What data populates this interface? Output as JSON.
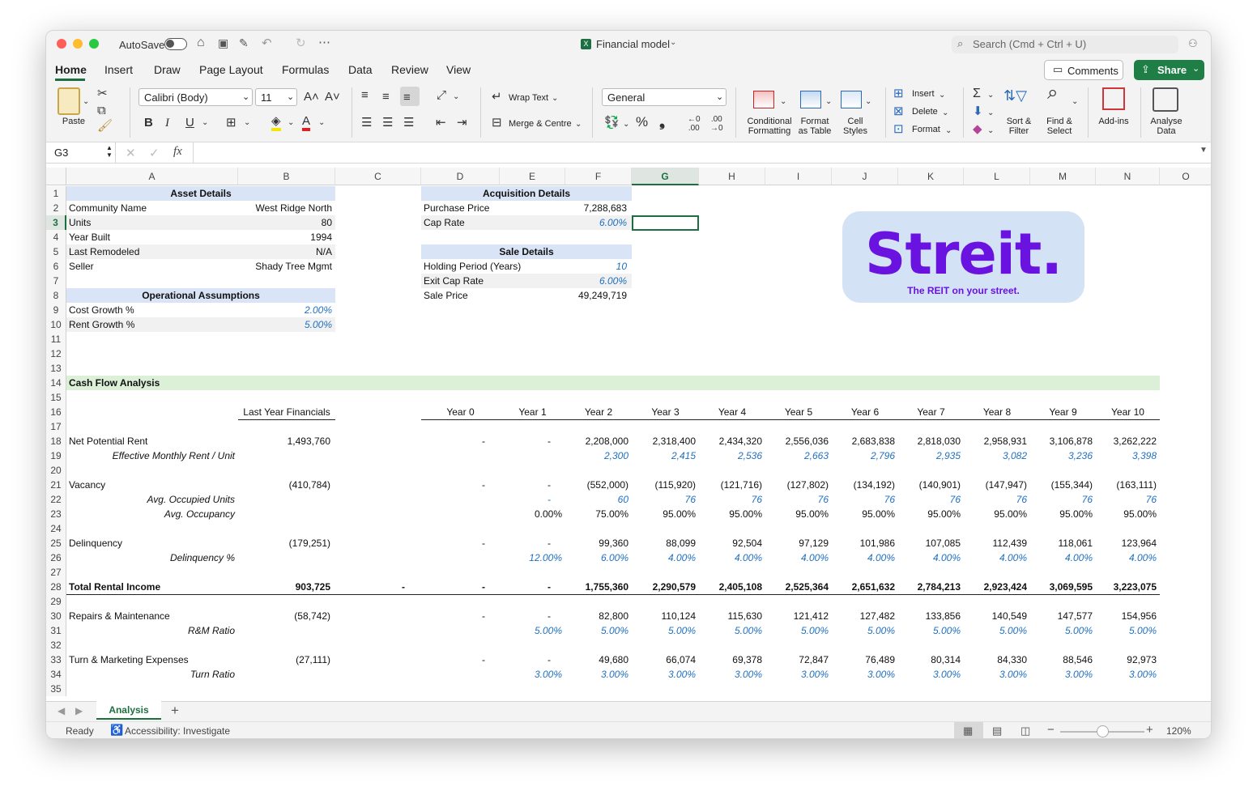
{
  "app": {
    "autosave": "AutoSave",
    "title": "Financial model",
    "search_placeholder": "Search (Cmd + Ctrl + U)"
  },
  "tabs": [
    "Home",
    "Insert",
    "Draw",
    "Page Layout",
    "Formulas",
    "Data",
    "Review",
    "View"
  ],
  "buttons": {
    "comments": "Comments",
    "share": "Share"
  },
  "ribbon": {
    "paste": "Paste",
    "font_name": "Calibri (Body)",
    "font_size": "11",
    "wrap_text": "Wrap Text",
    "merge": "Merge & Centre",
    "number_format": "General",
    "cond_fmt_1": "Conditional",
    "cond_fmt_2": "Formatting",
    "fmt_table_1": "Format",
    "fmt_table_2": "as Table",
    "cell_styles_1": "Cell",
    "cell_styles_2": "Styles",
    "insert": "Insert",
    "delete": "Delete",
    "format": "Format",
    "sort_1": "Sort &",
    "sort_2": "Filter",
    "find_1": "Find &",
    "find_2": "Select",
    "addins": "Add-ins",
    "analyse_1": "Analyse",
    "analyse_2": "Data"
  },
  "formula_bar": {
    "name_box": "G3",
    "fx": "fx",
    "value": ""
  },
  "columns": [
    "A",
    "B",
    "C",
    "D",
    "E",
    "F",
    "G",
    "H",
    "I",
    "J",
    "K",
    "L",
    "M",
    "N",
    "O"
  ],
  "rows": [
    "1",
    "2",
    "3",
    "4",
    "5",
    "6",
    "7",
    "8",
    "9",
    "10",
    "11",
    "12",
    "13",
    "14",
    "15",
    "16",
    "17",
    "18",
    "19",
    "20",
    "21",
    "22",
    "23",
    "24",
    "25",
    "26",
    "27",
    "28",
    "29",
    "30",
    "31",
    "32",
    "33",
    "34",
    "35"
  ],
  "asset": {
    "title": "Asset Details",
    "rows": [
      [
        "Community Name",
        "West Ridge North"
      ],
      [
        "Units",
        "80"
      ],
      [
        "Year Built",
        "1994"
      ],
      [
        "Last Remodeled",
        "N/A"
      ],
      [
        "Seller",
        "Shady Tree Mgmt"
      ]
    ]
  },
  "ops": {
    "title": "Operational Assumptions",
    "rows": [
      [
        "Cost Growth %",
        "2.00%"
      ],
      [
        "Rent Growth %",
        "5.00%"
      ]
    ]
  },
  "acq": {
    "title": "Acquisition Details",
    "rows": [
      [
        "Purchase Price",
        "7,288,683"
      ],
      [
        "Cap Rate",
        "6.00%"
      ]
    ]
  },
  "sale": {
    "title": "Sale Details",
    "rows": [
      [
        "Holding Period (Years)",
        "10"
      ],
      [
        "Exit Cap Rate",
        "6.00%"
      ],
      [
        "Sale Price",
        "49,249,719"
      ]
    ]
  },
  "logo": {
    "name": "Streit.",
    "tagline": "The REIT on your street."
  },
  "cashflow": {
    "title": "Cash Flow Analysis",
    "last_year": "Last Year Financials",
    "years": [
      "Year 0",
      "Year 1",
      "Year 2",
      "Year 3",
      "Year 4",
      "Year 5",
      "Year 6",
      "Year 7",
      "Year 8",
      "Year 9",
      "Year 10"
    ],
    "lines": [
      {
        "row": 18,
        "label": "Net Potential Rent",
        "b": "1,493,760",
        "c": "",
        "vals": [
          "-",
          "-",
          "2,208,000",
          "2,318,400",
          "2,434,320",
          "2,556,036",
          "2,683,838",
          "2,818,030",
          "2,958,931",
          "3,106,878",
          "3,262,222"
        ],
        "style": "plain"
      },
      {
        "row": 19,
        "label": "Effective Monthly Rent / Unit",
        "b": "",
        "c": "",
        "vals": [
          "",
          "",
          "2,300",
          "2,415",
          "2,536",
          "2,663",
          "2,796",
          "2,935",
          "3,082",
          "3,236",
          "3,398"
        ],
        "style": "sub"
      },
      {
        "row": 21,
        "label": "Vacancy",
        "b": "(410,784)",
        "c": "",
        "vals": [
          "-",
          "-",
          "(552,000)",
          "(115,920)",
          "(121,716)",
          "(127,802)",
          "(134,192)",
          "(140,901)",
          "(147,947)",
          "(155,344)",
          "(163,111)"
        ],
        "style": "plain"
      },
      {
        "row": 22,
        "label": "Avg. Occupied Units",
        "b": "",
        "c": "",
        "vals": [
          "",
          "-",
          "60",
          "76",
          "76",
          "76",
          "76",
          "76",
          "76",
          "76",
          "76"
        ],
        "style": "sub"
      },
      {
        "row": 23,
        "label": "Avg. Occupancy",
        "b": "",
        "c": "",
        "vals": [
          "",
          "0.00%",
          "75.00%",
          "95.00%",
          "95.00%",
          "95.00%",
          "95.00%",
          "95.00%",
          "95.00%",
          "95.00%",
          "95.00%"
        ],
        "style": "subblack"
      },
      {
        "row": 25,
        "label": "Delinquency",
        "b": "(179,251)",
        "c": "",
        "vals": [
          "-",
          "-",
          "99,360",
          "88,099",
          "92,504",
          "97,129",
          "101,986",
          "107,085",
          "112,439",
          "118,061",
          "123,964"
        ],
        "style": "plain"
      },
      {
        "row": 26,
        "label": "Delinquency %",
        "b": "",
        "c": "",
        "vals": [
          "",
          "12.00%",
          "6.00%",
          "4.00%",
          "4.00%",
          "4.00%",
          "4.00%",
          "4.00%",
          "4.00%",
          "4.00%",
          "4.00%"
        ],
        "style": "sub"
      },
      {
        "row": 28,
        "label": "Total Rental Income",
        "b": "903,725",
        "c": "-",
        "vals": [
          "-",
          "-",
          "1,755,360",
          "2,290,579",
          "2,405,108",
          "2,525,364",
          "2,651,632",
          "2,784,213",
          "2,923,424",
          "3,069,595",
          "3,223,075"
        ],
        "style": "bold"
      },
      {
        "row": 30,
        "label": "Repairs & Maintenance",
        "b": "(58,742)",
        "c": "",
        "vals": [
          "-",
          "-",
          "82,800",
          "110,124",
          "115,630",
          "121,412",
          "127,482",
          "133,856",
          "140,549",
          "147,577",
          "154,956"
        ],
        "style": "plain"
      },
      {
        "row": 31,
        "label": "R&M Ratio",
        "b": "",
        "c": "",
        "vals": [
          "",
          "5.00%",
          "5.00%",
          "5.00%",
          "5.00%",
          "5.00%",
          "5.00%",
          "5.00%",
          "5.00%",
          "5.00%",
          "5.00%"
        ],
        "style": "sub"
      },
      {
        "row": 33,
        "label": "Turn & Marketing Expenses",
        "b": "(27,111)",
        "c": "",
        "vals": [
          "-",
          "-",
          "49,680",
          "66,074",
          "69,378",
          "72,847",
          "76,489",
          "80,314",
          "84,330",
          "88,546",
          "92,973"
        ],
        "style": "plain"
      },
      {
        "row": 34,
        "label": "Turn Ratio",
        "b": "",
        "c": "",
        "vals": [
          "",
          "3.00%",
          "3.00%",
          "3.00%",
          "3.00%",
          "3.00%",
          "3.00%",
          "3.00%",
          "3.00%",
          "3.00%",
          "3.00%"
        ],
        "style": "sub"
      }
    ]
  },
  "sheet_tab": "Analysis",
  "status": {
    "ready": "Ready",
    "accessibility": "Accessibility: Investigate",
    "zoom": "120%"
  }
}
